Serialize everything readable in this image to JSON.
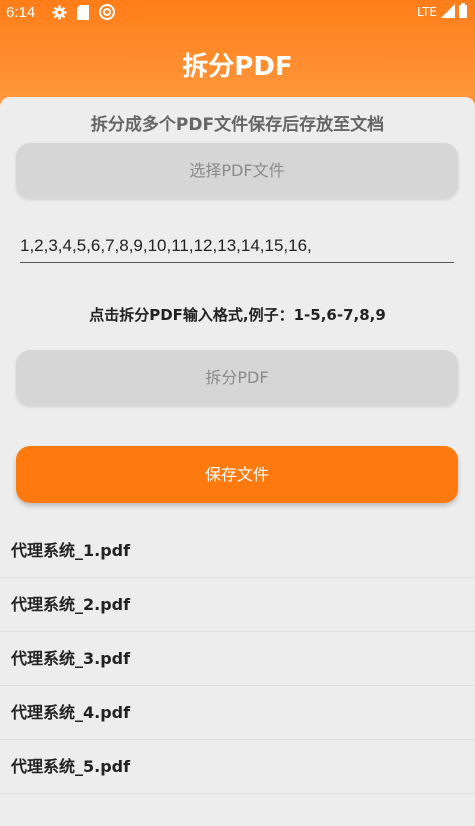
{
  "status_bar": {
    "time": "6:14",
    "network": "LTE",
    "icons": [
      "gear-icon",
      "sd-card-icon",
      "sync-icon",
      "signal-icon",
      "battery-icon"
    ]
  },
  "header": {
    "title": "拆分PDF"
  },
  "main": {
    "subtitle": "拆分成多个PDF文件保存后存放至文档",
    "select_button": "选择PDF文件",
    "page_range_value": "1,2,3,4,5,6,7,8,9,10,11,12,13,14,15,16,",
    "hint": "点击拆分PDF输入格式,例子：1-5,6-7,8,9",
    "split_button": "拆分PDF",
    "save_button": "保存文件"
  },
  "files": [
    {
      "name": "代理系统_1.pdf"
    },
    {
      "name": "代理系统_2.pdf"
    },
    {
      "name": "代理系统_3.pdf"
    },
    {
      "name": "代理系统_4.pdf"
    },
    {
      "name": "代理系统_5.pdf"
    }
  ],
  "colors": {
    "accent": "#ff7a0e",
    "button_disabled": "#d6d6d6",
    "background": "#ededed"
  }
}
